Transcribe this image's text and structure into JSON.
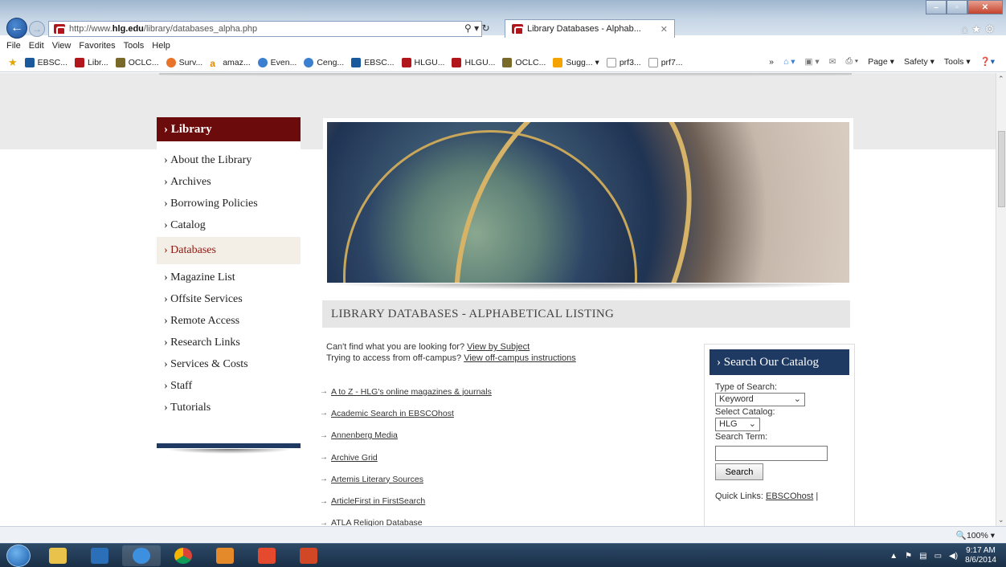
{
  "browser": {
    "url_prefix": "http://www.",
    "url_domain": "hlg.edu",
    "url_path": "/library/databases_alpha.php",
    "tab_title": "Library Databases - Alphab...",
    "menu": [
      "File",
      "Edit",
      "View",
      "Favorites",
      "Tools",
      "Help"
    ],
    "favorites": [
      "EBSC...",
      "Libr...",
      "OCLC...",
      "Surv...",
      "amaz...",
      "Even...",
      "Ceng...",
      "EBSC...",
      "HLGU...",
      "HLGU...",
      "OCLC...",
      "Sugg...",
      "prf3...",
      "prf7..."
    ],
    "command_bar": [
      "Page",
      "Safety",
      "Tools"
    ],
    "zoom": "100%"
  },
  "sidebar": {
    "heading": "› Library",
    "items": [
      "About the Library",
      "Archives",
      "Borrowing Policies",
      "Catalog",
      "Databases",
      "Magazine List",
      "Offsite Services",
      "Remote Access",
      "Research Links",
      "Services & Costs",
      "Staff",
      "Tutorials"
    ],
    "active": "Databases"
  },
  "main": {
    "page_title": "LIBRARY DATABASES - ALPHABETICAL LISTING",
    "intro1_text": "Can't find what you are looking for?",
    "intro1_link": "View by Subject",
    "intro2_text": "Trying to access from off-campus?",
    "intro2_link": "View off-campus instructions",
    "databases": [
      "A to Z - HLG's online magazines & journals",
      "Academic Search in EBSCOhost",
      "Annenberg Media",
      "Archive Grid",
      "Artemis Literary Sources",
      "ArticleFirst in FirstSearch",
      "ATLA Religion Database"
    ]
  },
  "catalog": {
    "heading": "› Search Our Catalog",
    "type_label": "Type of Search:",
    "type_value": "Keyword",
    "catalog_label": "Select Catalog:",
    "catalog_value": "HLG",
    "term_label": "Search Term:",
    "search_button": "Search",
    "quick_links_label": "Quick Links:",
    "quick_links_first": "EBSCOhost"
  },
  "taskbar": {
    "time": "9:17 AM",
    "date": "8/6/2014"
  }
}
